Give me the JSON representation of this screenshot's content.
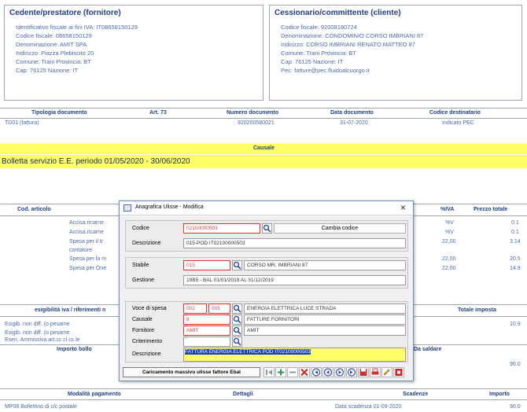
{
  "seller": {
    "title": "Cedente/prestatore (fornitore)",
    "lines": [
      "Identificativo fiscale ai fini IVA: IT08658150129",
      "Codice fiscale: 08658150129",
      "Denominazione: AMIT SPA",
      "Indirizzo: Piazza Plebiscito 20",
      "Comune: Trani Provincia: BT",
      "Cap: 76125 Nazione: IT"
    ]
  },
  "buyer": {
    "title": "Cessionario/committente (cliente)",
    "lines": [
      "Codice fiscale: 92008180724",
      "Denominazione: CONDOMINIO CORSO IMBRIANI 87",
      "Indirizzo: CORSO IMBRIANI RENATO MATTEO 87",
      "Comune: Trani Provincia: BT",
      "Cap: 76125 Nazione: IT",
      "Pec: fatture@pec.fluidoalcuorgo.it"
    ]
  },
  "doc_table": {
    "headers": [
      "Tipologia documento",
      "Art. 73",
      "Numero documento",
      "Data documento",
      "Codice destinatario"
    ],
    "values": [
      "TD01 (fattura)",
      "",
      "920200580021",
      "31-07-2020",
      "Indicato PEC"
    ]
  },
  "causale": {
    "header": "Causale",
    "text": "Bolletta servizio E.E. periodo 01/05/2020 - 30/06/2020"
  },
  "lines_table": {
    "header_left": "Cod. articolo",
    "header_right": [
      "%IVA",
      "Prezzo totale"
    ],
    "rows": [
      {
        "desc": "Accisa.ricarne",
        "iva": "%V",
        "tot": "0.1"
      },
      {
        "desc": "Accisa.ricarne",
        "iva": "%V",
        "tot": "0.1"
      },
      {
        "desc": "Spesa per il tr",
        "iva": "22,00",
        "tot": "3.14"
      },
      {
        "desc": "contatore",
        "iva": "",
        "tot": ""
      },
      {
        "desc": "Spesa per la m",
        "iva": "22,00",
        "tot": "20.5"
      },
      {
        "desc": "Spesa per One",
        "iva": "22,00",
        "tot": "14.9"
      }
    ]
  },
  "summary": {
    "header_left": "esigibilità iva / riferimenti n",
    "header_right": "Totale imposta",
    "rows": [
      {
        "text": "Esigib. non diff. (o pesame",
        "val": "10.9"
      },
      {
        "text": "Esigib. non diff. (o pesame",
        "val": ""
      },
      {
        "text": "Esen. Ammissiva art.cc cl cc.le",
        "val": ""
      }
    ],
    "importo_label": "Importo bollo",
    "scadenza_label": "Da saldare",
    "extra_val": "90.0"
  },
  "payment": {
    "headers": [
      "Modalità pagamento",
      "Dettagli",
      "Scadenze",
      "Importo"
    ],
    "row": [
      "MP08 Bollettino di c/c postale",
      "",
      "Data scadenza 01-09-2020",
      "90.0"
    ]
  },
  "dialog": {
    "title": "Anagrafica Ulisse - Modifica",
    "close": "×",
    "codice_label": "Codice",
    "codice_value": "02100000503",
    "cambia_label": "Cambia codice",
    "descrizione_label": "Descrizione",
    "descrizione_value": "015-POD IT02100000503",
    "stabile_label": "Stabile",
    "stabile_code": "015",
    "stabile_desc": "CORSO MR. IMBRIANI 87",
    "gestione_label": "Gestione",
    "gestione_value": "19B5 - BAL 01/01/2019 AL 31/12/2019",
    "voce_label": "Voce di spesa",
    "voce_code1": "002",
    "voce_code2": "005",
    "voce_desc": "ENERGIA ELETTRICA LUCE STRADA",
    "causale_label": "Causale",
    "causale_code": "8",
    "causale_desc": "FATTURE FORNITORI",
    "fornitore_label": "Fornitore",
    "fornitore_code": "AMIT",
    "fornitore_desc": "AMIT",
    "criterio_label": "Criterimento",
    "criterio_code": "",
    "descr2_label": "Descrizione",
    "descr2_value": "FATTURA ENERGIA ELETTRICA POD IT02100000503",
    "footer_button": "Caricamento massivo ulisse fattore Ebal"
  }
}
